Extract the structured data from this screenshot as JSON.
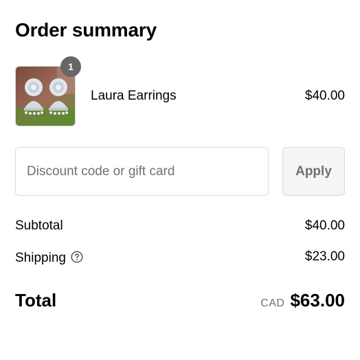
{
  "order_summary": {
    "title": "Order summary",
    "line_items": [
      {
        "name": "Laura Earrings",
        "price": "$40.00",
        "quantity": "1"
      }
    ],
    "discount": {
      "placeholder": "Discount code or gift card",
      "value": "",
      "apply_label": "Apply"
    },
    "subtotal": {
      "label": "Subtotal",
      "value": "$40.00"
    },
    "shipping": {
      "label": "Shipping",
      "value": "$23.00",
      "help_icon": "question-circle-icon"
    },
    "total": {
      "label": "Total",
      "currency": "CAD",
      "value": "$63.00"
    }
  },
  "colors": {
    "text": "#000000",
    "muted_text": "#707070",
    "border": "#d9d9d9",
    "button_bg": "#f5f5f5",
    "badge_bg": "#666666"
  }
}
